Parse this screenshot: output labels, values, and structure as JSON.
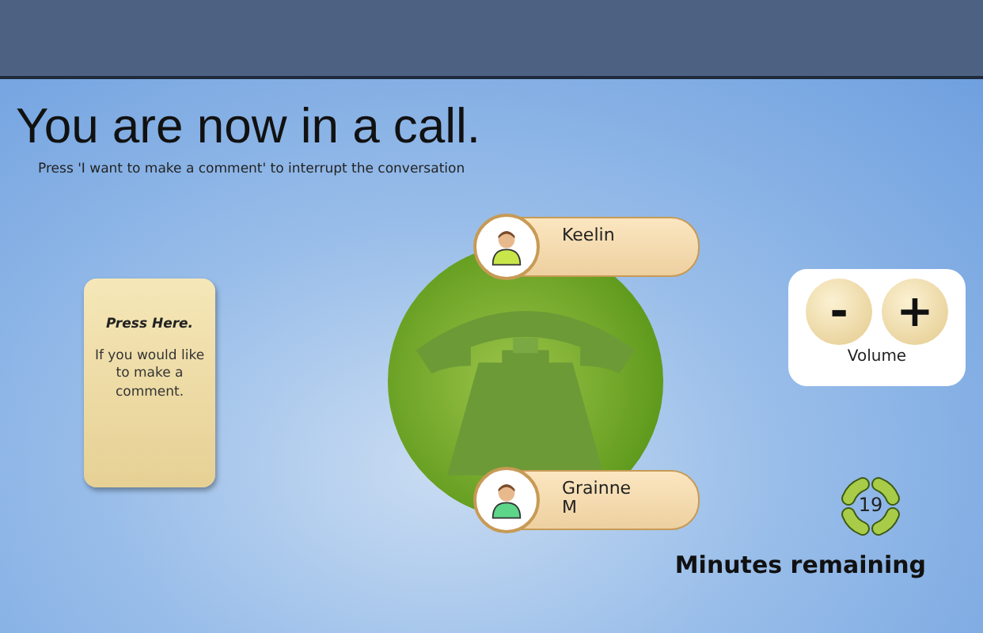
{
  "title": "You are now in a call.",
  "instruction": "Press 'I want to make a comment' to interrupt the conversation",
  "comment_button": {
    "heading": "Press Here.",
    "text": "If you would like to make a comment."
  },
  "participants": [
    {
      "name": "Keelin",
      "color": "#c8e64a"
    },
    {
      "name": "Grainne M",
      "color": "#5ed68a"
    }
  ],
  "volume": {
    "buttons": [
      "-",
      "+"
    ],
    "label": "Volume"
  },
  "timer": {
    "value": "19",
    "label": "Minutes remaining"
  }
}
